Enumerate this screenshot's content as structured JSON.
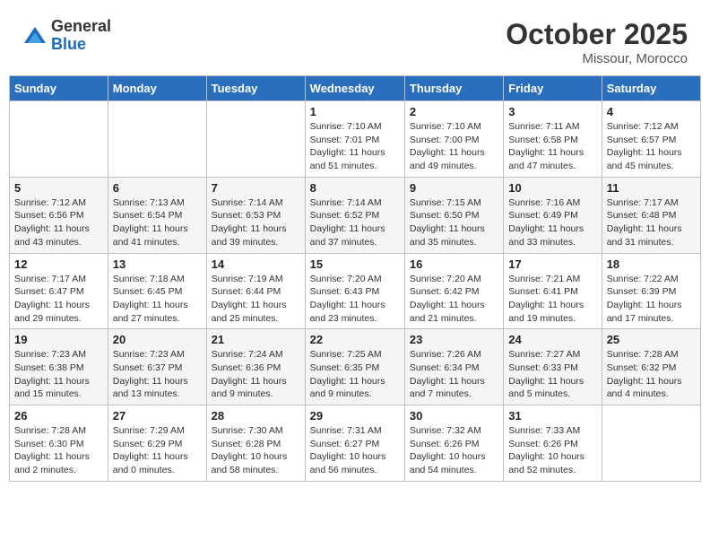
{
  "logo": {
    "general": "General",
    "blue": "Blue"
  },
  "title": "October 2025",
  "location": "Missour, Morocco",
  "weekdays": [
    "Sunday",
    "Monday",
    "Tuesday",
    "Wednesday",
    "Thursday",
    "Friday",
    "Saturday"
  ],
  "weeks": [
    [
      {
        "day": "",
        "info": ""
      },
      {
        "day": "",
        "info": ""
      },
      {
        "day": "",
        "info": ""
      },
      {
        "day": "1",
        "sunrise": "Sunrise: 7:10 AM",
        "sunset": "Sunset: 7:01 PM",
        "daylight": "Daylight: 11 hours and 51 minutes."
      },
      {
        "day": "2",
        "sunrise": "Sunrise: 7:10 AM",
        "sunset": "Sunset: 7:00 PM",
        "daylight": "Daylight: 11 hours and 49 minutes."
      },
      {
        "day": "3",
        "sunrise": "Sunrise: 7:11 AM",
        "sunset": "Sunset: 6:58 PM",
        "daylight": "Daylight: 11 hours and 47 minutes."
      },
      {
        "day": "4",
        "sunrise": "Sunrise: 7:12 AM",
        "sunset": "Sunset: 6:57 PM",
        "daylight": "Daylight: 11 hours and 45 minutes."
      }
    ],
    [
      {
        "day": "5",
        "sunrise": "Sunrise: 7:12 AM",
        "sunset": "Sunset: 6:56 PM",
        "daylight": "Daylight: 11 hours and 43 minutes."
      },
      {
        "day": "6",
        "sunrise": "Sunrise: 7:13 AM",
        "sunset": "Sunset: 6:54 PM",
        "daylight": "Daylight: 11 hours and 41 minutes."
      },
      {
        "day": "7",
        "sunrise": "Sunrise: 7:14 AM",
        "sunset": "Sunset: 6:53 PM",
        "daylight": "Daylight: 11 hours and 39 minutes."
      },
      {
        "day": "8",
        "sunrise": "Sunrise: 7:14 AM",
        "sunset": "Sunset: 6:52 PM",
        "daylight": "Daylight: 11 hours and 37 minutes."
      },
      {
        "day": "9",
        "sunrise": "Sunrise: 7:15 AM",
        "sunset": "Sunset: 6:50 PM",
        "daylight": "Daylight: 11 hours and 35 minutes."
      },
      {
        "day": "10",
        "sunrise": "Sunrise: 7:16 AM",
        "sunset": "Sunset: 6:49 PM",
        "daylight": "Daylight: 11 hours and 33 minutes."
      },
      {
        "day": "11",
        "sunrise": "Sunrise: 7:17 AM",
        "sunset": "Sunset: 6:48 PM",
        "daylight": "Daylight: 11 hours and 31 minutes."
      }
    ],
    [
      {
        "day": "12",
        "sunrise": "Sunrise: 7:17 AM",
        "sunset": "Sunset: 6:47 PM",
        "daylight": "Daylight: 11 hours and 29 minutes."
      },
      {
        "day": "13",
        "sunrise": "Sunrise: 7:18 AM",
        "sunset": "Sunset: 6:45 PM",
        "daylight": "Daylight: 11 hours and 27 minutes."
      },
      {
        "day": "14",
        "sunrise": "Sunrise: 7:19 AM",
        "sunset": "Sunset: 6:44 PM",
        "daylight": "Daylight: 11 hours and 25 minutes."
      },
      {
        "day": "15",
        "sunrise": "Sunrise: 7:20 AM",
        "sunset": "Sunset: 6:43 PM",
        "daylight": "Daylight: 11 hours and 23 minutes."
      },
      {
        "day": "16",
        "sunrise": "Sunrise: 7:20 AM",
        "sunset": "Sunset: 6:42 PM",
        "daylight": "Daylight: 11 hours and 21 minutes."
      },
      {
        "day": "17",
        "sunrise": "Sunrise: 7:21 AM",
        "sunset": "Sunset: 6:41 PM",
        "daylight": "Daylight: 11 hours and 19 minutes."
      },
      {
        "day": "18",
        "sunrise": "Sunrise: 7:22 AM",
        "sunset": "Sunset: 6:39 PM",
        "daylight": "Daylight: 11 hours and 17 minutes."
      }
    ],
    [
      {
        "day": "19",
        "sunrise": "Sunrise: 7:23 AM",
        "sunset": "Sunset: 6:38 PM",
        "daylight": "Daylight: 11 hours and 15 minutes."
      },
      {
        "day": "20",
        "sunrise": "Sunrise: 7:23 AM",
        "sunset": "Sunset: 6:37 PM",
        "daylight": "Daylight: 11 hours and 13 minutes."
      },
      {
        "day": "21",
        "sunrise": "Sunrise: 7:24 AM",
        "sunset": "Sunset: 6:36 PM",
        "daylight": "Daylight: 11 hours and 9 minutes."
      },
      {
        "day": "22",
        "sunrise": "Sunrise: 7:25 AM",
        "sunset": "Sunset: 6:35 PM",
        "daylight": "Daylight: 11 hours and 9 minutes."
      },
      {
        "day": "23",
        "sunrise": "Sunrise: 7:26 AM",
        "sunset": "Sunset: 6:34 PM",
        "daylight": "Daylight: 11 hours and 7 minutes."
      },
      {
        "day": "24",
        "sunrise": "Sunrise: 7:27 AM",
        "sunset": "Sunset: 6:33 PM",
        "daylight": "Daylight: 11 hours and 5 minutes."
      },
      {
        "day": "25",
        "sunrise": "Sunrise: 7:28 AM",
        "sunset": "Sunset: 6:32 PM",
        "daylight": "Daylight: 11 hours and 4 minutes."
      }
    ],
    [
      {
        "day": "26",
        "sunrise": "Sunrise: 7:28 AM",
        "sunset": "Sunset: 6:30 PM",
        "daylight": "Daylight: 11 hours and 2 minutes."
      },
      {
        "day": "27",
        "sunrise": "Sunrise: 7:29 AM",
        "sunset": "Sunset: 6:29 PM",
        "daylight": "Daylight: 11 hours and 0 minutes."
      },
      {
        "day": "28",
        "sunrise": "Sunrise: 7:30 AM",
        "sunset": "Sunset: 6:28 PM",
        "daylight": "Daylight: 10 hours and 58 minutes."
      },
      {
        "day": "29",
        "sunrise": "Sunrise: 7:31 AM",
        "sunset": "Sunset: 6:27 PM",
        "daylight": "Daylight: 10 hours and 56 minutes."
      },
      {
        "day": "30",
        "sunrise": "Sunrise: 7:32 AM",
        "sunset": "Sunset: 6:26 PM",
        "daylight": "Daylight: 10 hours and 54 minutes."
      },
      {
        "day": "31",
        "sunrise": "Sunrise: 7:33 AM",
        "sunset": "Sunset: 6:26 PM",
        "daylight": "Daylight: 10 hours and 52 minutes."
      },
      {
        "day": "",
        "info": ""
      }
    ]
  ]
}
